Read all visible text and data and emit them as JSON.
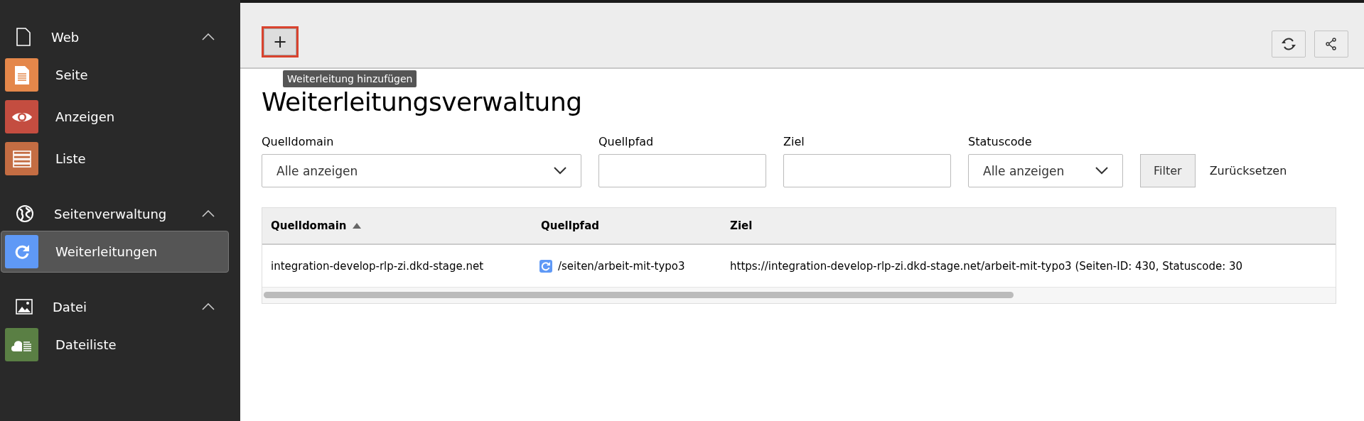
{
  "sidebar": {
    "groups": [
      {
        "label": "Web",
        "kind": "page",
        "expanded": true,
        "items": [
          {
            "label": "Seite",
            "kind": "page",
            "color": "#e4874a",
            "selected": false
          },
          {
            "label": "Anzeigen",
            "kind": "eye",
            "color": "#c44d40",
            "selected": false
          },
          {
            "label": "Liste",
            "kind": "list",
            "color": "#c46d43",
            "selected": false
          }
        ]
      },
      {
        "label": "Seitenverwaltung",
        "kind": "globe",
        "expanded": true,
        "items": [
          {
            "label": "Weiterleitungen",
            "kind": "redirect",
            "color": "#5f99f6",
            "selected": true
          }
        ]
      },
      {
        "label": "Datei",
        "kind": "image",
        "expanded": true,
        "items": [
          {
            "label": "Dateiliste",
            "kind": "cloud",
            "color": "#5a7f44",
            "selected": false
          }
        ]
      }
    ]
  },
  "toolbar": {
    "add_button": {
      "label": "+",
      "tooltip": "Weiterleitung hinzufügen"
    }
  },
  "title": "Weiterleitungsverwaltung",
  "filters": [
    {
      "label": "Quelldomain",
      "kind": "select",
      "value": "Alle anzeigen"
    },
    {
      "label": "Quellpfad",
      "kind": "input"
    },
    {
      "label": "Ziel",
      "kind": "input"
    },
    {
      "label": "Statuscode",
      "kind": "select",
      "value": "Alle anzeigen"
    }
  ],
  "filter_button": "Filter",
  "reset_link": "Zurücksetzen",
  "table": {
    "columns": [
      {
        "label": "Quelldomain",
        "sorted": true
      },
      {
        "label": "Quellpfad",
        "sorted": false
      },
      {
        "label": "Ziel",
        "sorted": false
      }
    ],
    "rows": [
      {
        "cells": [
          "integration-develop-rlp-zi.dkd-stage.net",
          "/seiten/arbeit-mit-typo3",
          "https://integration-develop-rlp-zi.dkd-stage.net/arbeit-mit-typo3 (Seiten-ID: 430, Statuscode: 30"
        ]
      }
    ]
  }
}
